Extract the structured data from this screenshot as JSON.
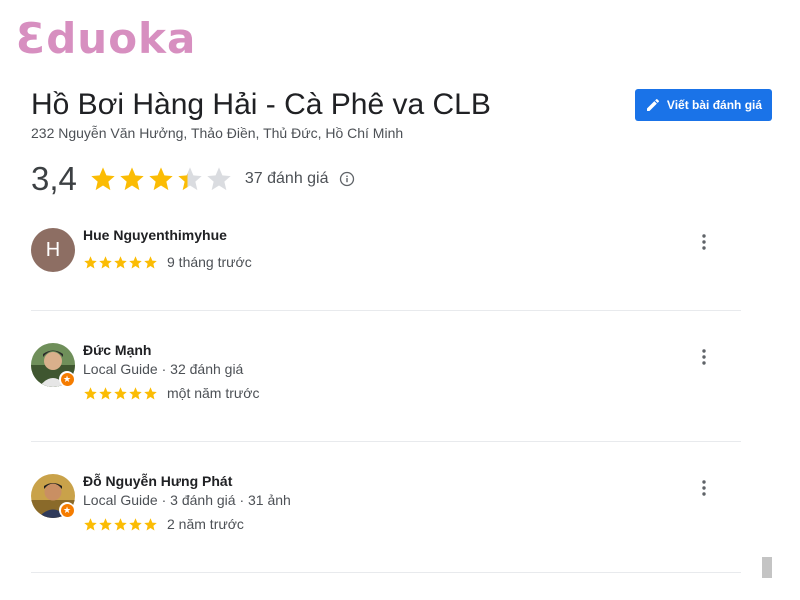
{
  "logo": {
    "text": "Ɛduoka"
  },
  "place": {
    "title": "Hồ Bơi Hàng Hải - Cà Phê va CLB",
    "address": "232 Nguyễn Văn Hưởng, Thảo Điền, Thủ Đức, Hồ Chí Minh",
    "rating": "3,4",
    "rating_value": 3.4,
    "review_count": "37 đánh giá"
  },
  "write_review_button": {
    "label": "Viết bài đánh giá",
    "icon": "pencil-icon"
  },
  "colors": {
    "accent": "#1a73e8",
    "star_filled": "#fbbc04",
    "star_empty": "#dadce0",
    "logo": "#d78fc0",
    "local_guide_badge": "#f57c00"
  },
  "reviews": [
    {
      "name": "Hue Nguyenthimyhue",
      "avatar_letter": "H",
      "meta": "",
      "stars": 5,
      "time": "9 tháng trước"
    },
    {
      "name": "Đức Mạnh",
      "avatar_letter": "",
      "meta": "Local Guide · 32 đánh giá",
      "stars": 5,
      "time": "một năm trước"
    },
    {
      "name": "Đỗ Nguyễn Hưng Phát",
      "avatar_letter": "",
      "meta": "Local Guide · 3 đánh giá · 31 ảnh",
      "stars": 5,
      "time": "2 năm trước"
    }
  ]
}
